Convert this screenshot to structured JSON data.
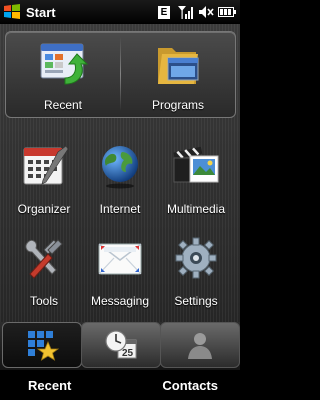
{
  "status_bar": {
    "start_label": "Start",
    "network_badge": "E",
    "icons": [
      "windows-logo-icon",
      "signal-icon",
      "volume-muted-icon",
      "battery-icon"
    ]
  },
  "top_panel": {
    "recent_label": "Recent",
    "programs_label": "Programs"
  },
  "grid": [
    {
      "label": "Organizer",
      "icon": "calendar-icon"
    },
    {
      "label": "Internet",
      "icon": "globe-icon"
    },
    {
      "label": "Multimedia",
      "icon": "clapperboard-icon"
    },
    {
      "label": "Tools",
      "icon": "tools-icon"
    },
    {
      "label": "Messaging",
      "icon": "envelope-icon"
    },
    {
      "label": "Settings",
      "icon": "gear-icon"
    }
  ],
  "tabs": [
    {
      "icon": "home-grid-star-icon",
      "active": true
    },
    {
      "icon": "clock-calendar-icon",
      "active": false
    },
    {
      "icon": "contacts-person-icon",
      "active": false
    }
  ],
  "softkeys": {
    "left": "Recent",
    "right": "Contacts"
  },
  "colors": {
    "background": "#000000",
    "panel": "#3a3a3a",
    "accent_green": "#3fb23a",
    "folder_yellow": "#e6b640",
    "text": "#ffffff"
  }
}
